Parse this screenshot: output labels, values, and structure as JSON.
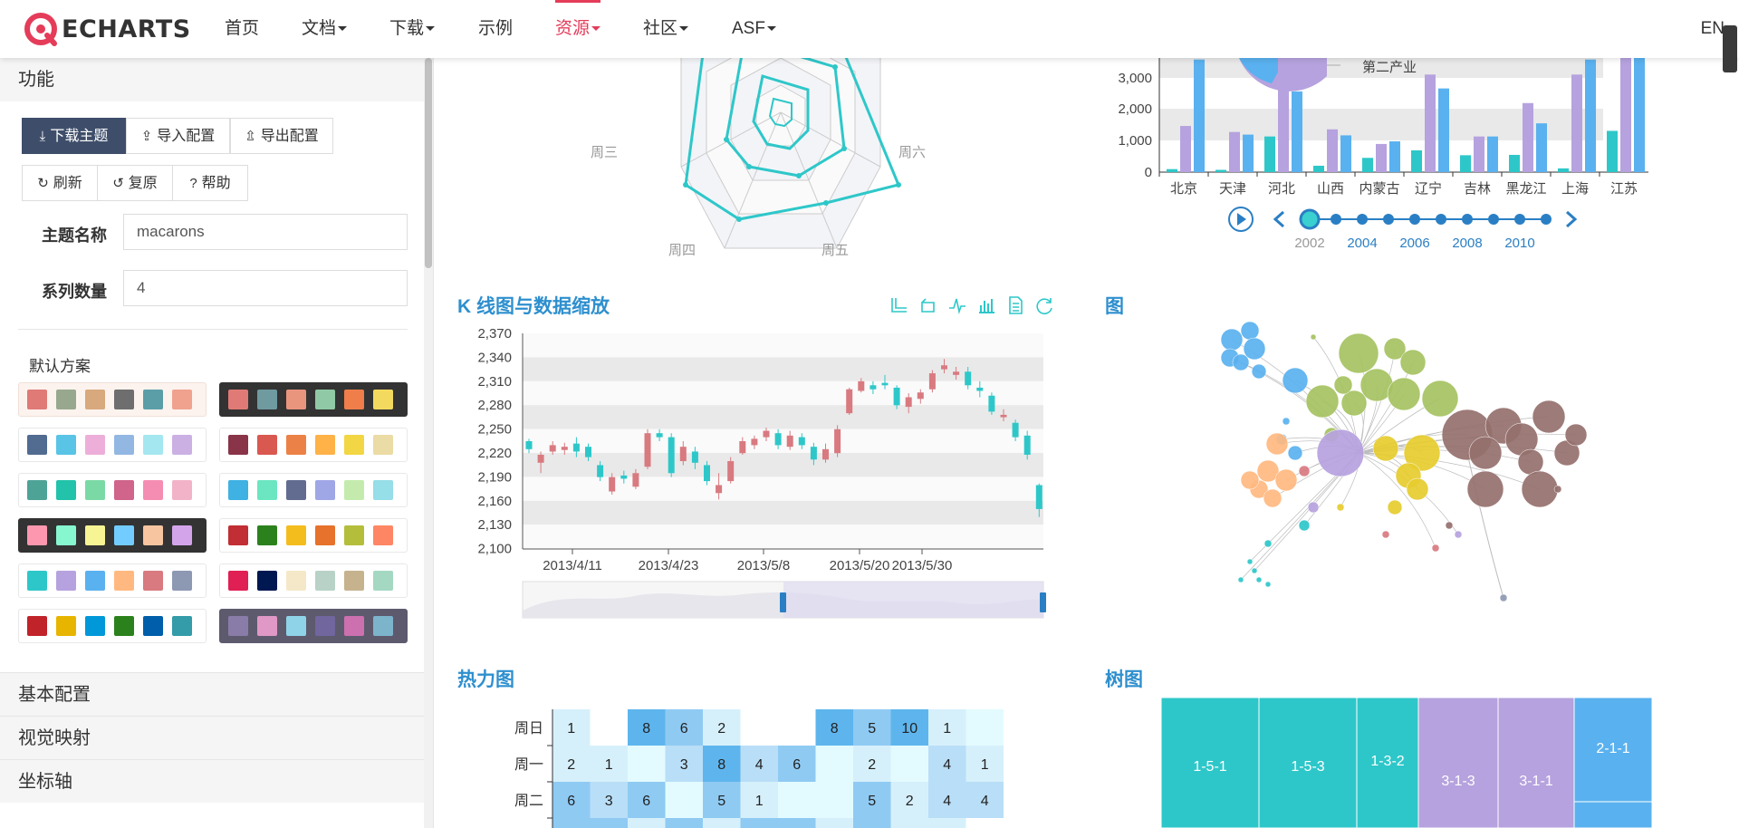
{
  "nav": {
    "logo_text": "ECHARTS",
    "items": [
      {
        "label": "首页",
        "caret": false,
        "active": false
      },
      {
        "label": "文档",
        "caret": true,
        "active": false
      },
      {
        "label": "下载",
        "caret": true,
        "active": false
      },
      {
        "label": "示例",
        "caret": false,
        "active": false
      },
      {
        "label": "资源",
        "caret": true,
        "active": true
      },
      {
        "label": "社区",
        "caret": true,
        "active": false
      },
      {
        "label": "ASF",
        "caret": true,
        "active": false
      }
    ],
    "lang": "EN"
  },
  "sidebar": {
    "section_function": "功能",
    "buttons": {
      "download_theme": "下载主题",
      "import_config": "导入配置",
      "export_config": "导出配置",
      "refresh": "刷新",
      "reset": "复原",
      "help": "帮助"
    },
    "theme_name_label": "主题名称",
    "theme_name_value": "macarons",
    "series_count_label": "系列数量",
    "series_count_value": "4",
    "default_scheme_label": "默认方案",
    "palettes": [
      [
        "#e07a76",
        "#98a88e",
        "#d8a97d",
        "#6e6e6e",
        "#5b9ea8",
        "#f0a28e"
      ],
      [
        "#e07a76",
        "#6f9aa0",
        "#e9957e",
        "#8fc9a5",
        "#ef7e4b",
        "#f3da5e"
      ],
      [
        "#516b91",
        "#59c4e6",
        "#edafda",
        "#93b7e3",
        "#a5e7f0",
        "#cbb0e3"
      ],
      [
        "#893448",
        "#d95850",
        "#eb8146",
        "#ffb248",
        "#f2d643",
        "#ebdba4"
      ],
      [
        "#4ea397",
        "#22c3aa",
        "#7bd9a5",
        "#d0648a",
        "#f58db2",
        "#f2b3c9"
      ],
      [
        "#3fb1e3",
        "#6be6c1",
        "#626c91",
        "#a0a7e6",
        "#c4ebad",
        "#96dee8"
      ],
      [
        "#fc97af",
        "#87f7cf",
        "#f7f494",
        "#72ccff",
        "#f7c5a0",
        "#d4a4eb"
      ],
      [
        "#c12e34",
        "#2b821d",
        "#f4bd1e",
        "#e6722b",
        "#b4be3b",
        "#ff8664"
      ],
      [
        "#2ec7c9",
        "#b6a2de",
        "#5ab1ef",
        "#ffb980",
        "#d87a80",
        "#8d98b3"
      ],
      [
        "#e01f54",
        "#001852",
        "#f5e8c8",
        "#b8d2c7",
        "#c6b38e",
        "#a4d8c2"
      ],
      [
        "#c1232b",
        "#e7b500",
        "#0098d9",
        "#2b821d",
        "#005eaa",
        "#339ca8"
      ],
      [
        "#8a7ca8",
        "#e098c7",
        "#8fd3e8",
        "#71669e",
        "#cc70af",
        "#7cb4cc"
      ]
    ],
    "palette_styles": [
      "pink",
      "dark",
      "",
      "",
      "",
      "",
      "dark",
      "",
      "",
      "",
      "",
      "dark2"
    ],
    "sections": [
      "基本配置",
      "视觉映射",
      "坐标轴"
    ]
  },
  "charts": {
    "radar": {
      "labels": [
        "周三",
        "周六",
        "周四",
        "周五"
      ]
    },
    "bar_timeline": {
      "legend_label": "第二产业",
      "yticks": [
        "3,000",
        "2,000",
        "1,000",
        "0"
      ],
      "categories": [
        "北京",
        "天津",
        "河北",
        "山西",
        "内蒙古",
        "辽宁",
        "吉林",
        "黑龙江",
        "上海",
        "江苏"
      ],
      "timeline_years": [
        "2002",
        "2004",
        "2006",
        "2008",
        "2010"
      ]
    },
    "kline": {
      "title": "K 线图与数据缩放",
      "yticks": [
        "2,370",
        "2,340",
        "2,310",
        "2,280",
        "2,250",
        "2,220",
        "2,190",
        "2,160",
        "2,130",
        "2,100"
      ],
      "xticks": [
        "2013/4/11",
        "2013/4/23",
        "2013/5/8",
        "2013/5/20",
        "2013/5/30"
      ]
    },
    "graph": {
      "title": "图"
    },
    "heatmap": {
      "title": "热力图",
      "days": [
        "周日",
        "周一",
        "周二"
      ]
    },
    "treemap": {
      "title": "树图",
      "cells": [
        "1-5-1",
        "1-5-3",
        "1-3-2",
        "3-1-3",
        "3-1-1",
        "2-1-1"
      ]
    }
  },
  "chart_data": [
    {
      "type": "bar",
      "categories": [
        "北京",
        "天津",
        "河北",
        "山西",
        "内蒙古",
        "辽宁",
        "吉林",
        "黑龙江",
        "上海",
        "江苏"
      ],
      "ylim": [
        0,
        3500
      ],
      "series": [
        {
          "values": [
            80,
            60,
            950,
            170,
            380,
            580,
            450,
            460,
            100,
            1100
          ]
        },
        {
          "name": "第二产业",
          "values": [
            1230,
            1070,
            3600,
            1140,
            750,
            2600,
            950,
            1840,
            2600,
            4000
          ]
        },
        {
          "values": [
            3000,
            1000,
            2150,
            980,
            820,
            2230,
            950,
            1300,
            3000,
            4000
          ]
        }
      ]
    },
    {
      "type": "line",
      "title": "K 线图与数据缩放",
      "x": [
        "2013/4/11",
        "2013/4/23",
        "2013/5/8",
        "2013/5/20",
        "2013/5/30"
      ],
      "ylim": [
        2100,
        2370
      ]
    },
    {
      "type": "heatmap",
      "title": "热力图",
      "rows": [
        "周日",
        "周一",
        "周二"
      ],
      "values": [
        [
          "1",
          "",
          "8",
          "6",
          "2",
          "",
          "",
          "8",
          "5",
          "10",
          "1",
          ""
        ],
        [
          "2",
          "1",
          "",
          "3",
          "8",
          "4",
          "6",
          "",
          "2",
          "",
          "4",
          "1"
        ],
        [
          "6",
          "3",
          "6",
          "",
          "5",
          "1",
          "",
          "",
          "5",
          "2",
          "4",
          "4"
        ]
      ]
    }
  ]
}
